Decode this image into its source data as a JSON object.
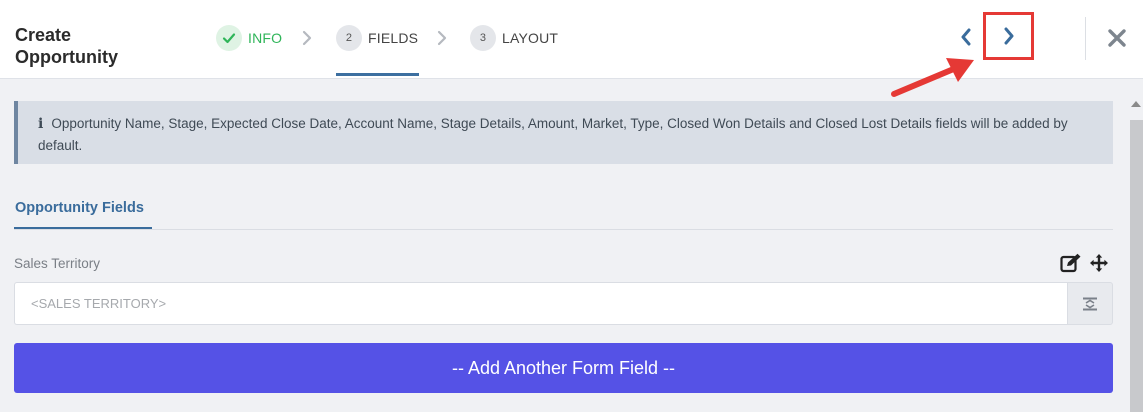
{
  "header": {
    "title": "Create Opportunity",
    "steps": [
      {
        "number": "",
        "label": "INFO",
        "state": "done",
        "icon": "check-icon"
      },
      {
        "number": "2",
        "label": "FIELDS",
        "state": "active"
      },
      {
        "number": "3",
        "label": "LAYOUT",
        "state": "pending"
      }
    ],
    "nav": {
      "prev_icon": "chevron-left-icon",
      "next_icon": "chevron-right-icon",
      "close_icon": "close-icon"
    }
  },
  "info_banner": {
    "icon": "info-icon",
    "text": "Opportunity Name, Stage, Expected Close Date, Account Name, Stage Details, Amount, Market, Type, Closed Won Details and Closed Lost Details fields will be added by default."
  },
  "tabs": [
    {
      "label": "Opportunity Fields",
      "active": true
    }
  ],
  "fields": [
    {
      "label": "Sales Territory",
      "placeholder": "<SALES TERRITORY>",
      "value": ""
    }
  ],
  "add_button_label": "-- Add Another Form Field --",
  "colors": {
    "accent": "#3a6c9c",
    "success": "#2fb559",
    "button": "#5552e6",
    "annotation": "#e53935"
  }
}
